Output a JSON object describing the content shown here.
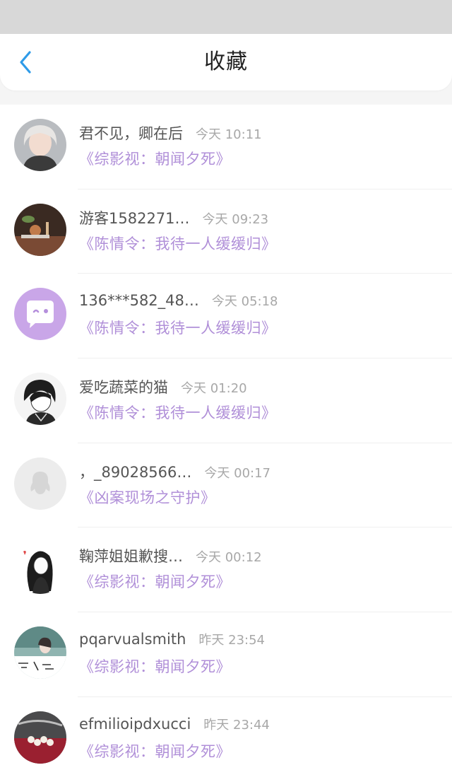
{
  "header": {
    "title": "收藏",
    "back_icon": "chevron-left-icon",
    "accent_color": "#2f9be8"
  },
  "list": {
    "name_color": "#555555",
    "time_color": "#a8a8a8",
    "book_color": "#b08fd8",
    "items": [
      {
        "name": "君不见，卿在后",
        "time": "今天 10:11",
        "book": "《综影视：朝闻夕死》",
        "avatar": "girl-photo"
      },
      {
        "name": "游客1582271…",
        "time": "今天 09:23",
        "book": "《陈情令：我待一人缓缓归》",
        "avatar": "tea-scene"
      },
      {
        "name": "136***582_48…",
        "time": "今天 05:18",
        "book": "《陈情令：我待一人缓缓归》",
        "avatar": "chat-bubble-icon"
      },
      {
        "name": "爱吃蔬菜的猫",
        "time": "今天 01:20",
        "book": "《陈情令：我待一人缓缓归》",
        "avatar": "anime-boy"
      },
      {
        "name": "，_89028566…",
        "time": "今天 00:17",
        "book": "《凶案现场之守护》",
        "avatar": "default-penguin-icon"
      },
      {
        "name": "鞠萍姐姐歉搜…",
        "time": "今天 00:12",
        "book": "《综影视：朝闻夕死》",
        "avatar": "anime-girl"
      },
      {
        "name": "pqarvualsmith",
        "time": "昨天 23:54",
        "book": "《综影视：朝闻夕死》",
        "avatar": "girl-landscape"
      },
      {
        "name": "efmilioipdxucci",
        "time": "昨天 23:44",
        "book": "《综影视：朝闻夕死》",
        "avatar": "pearls-photo"
      }
    ]
  }
}
